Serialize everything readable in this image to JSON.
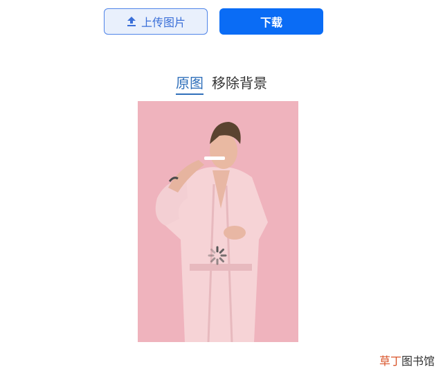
{
  "toolbar": {
    "upload_label": "上传图片",
    "download_label": "下载"
  },
  "tabs": [
    {
      "label": "原图",
      "active": true
    },
    {
      "label": "移除背景",
      "active": false
    }
  ],
  "image": {
    "background_color": "#efb3bd",
    "loading": true
  },
  "watermark": {
    "accent": "草丁",
    "rest": "图书馆"
  },
  "colors": {
    "primary": "#0a6cf5",
    "upload_bg": "#e9f0fc",
    "active_tab": "#2f6fba"
  }
}
